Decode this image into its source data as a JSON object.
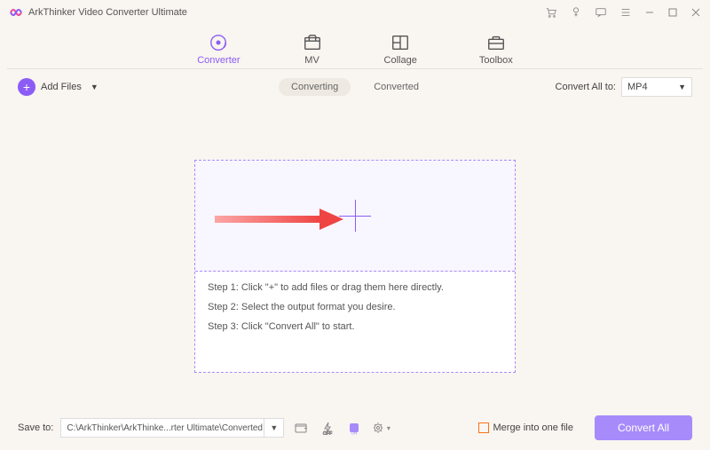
{
  "app": {
    "title": "ArkThinker Video Converter Ultimate"
  },
  "tabs": {
    "converter": "Converter",
    "mv": "MV",
    "collage": "Collage",
    "toolbox": "Toolbox"
  },
  "toolbar": {
    "add_files": "Add Files",
    "converting": "Converting",
    "converted": "Converted",
    "convert_all_to": "Convert All to:",
    "format": "MP4"
  },
  "dropzone": {
    "step1": "Step 1: Click \"+\" to add files or drag them here directly.",
    "step2": "Step 2: Select the output format you desire.",
    "step3": "Step 3: Click \"Convert All\" to start."
  },
  "bottom": {
    "save_to": "Save to:",
    "path": "C:\\ArkThinker\\ArkThinke...rter Ultimate\\Converted",
    "merge": "Merge into one file",
    "convert_all": "Convert All"
  }
}
